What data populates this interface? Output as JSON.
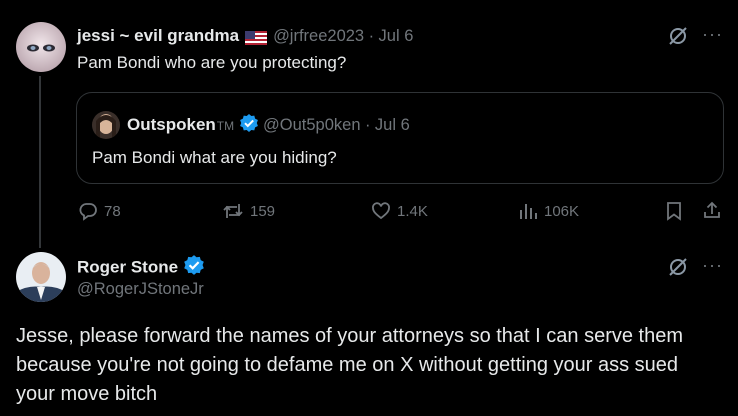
{
  "parent_tweet": {
    "display_name": "jessi ~ evil grandma",
    "flag": "us-flag-icon",
    "handle": "@jrfree2023",
    "separator": "·",
    "date": "Jul 6",
    "text": "Pam Bondi who are you protecting?",
    "quote": {
      "display_name": "Outspoken",
      "name_suffix": "TM",
      "handle": "@Out5p0ken",
      "separator": "·",
      "date": "Jul 6",
      "text": "Pam Bondi what are you hiding?"
    },
    "actions": {
      "replies": "78",
      "reposts": "159",
      "likes": "1.4K",
      "views": "106K"
    }
  },
  "reply_tweet": {
    "display_name": "Roger Stone",
    "handle": "@RogerJStoneJr",
    "text": "Jesse, please forward the names of your attorneys so that I can serve them because you're not going to defame me on X without getting your ass sued your move bitch"
  },
  "colors": {
    "background": "#000000",
    "text": "#e7e9ea",
    "muted": "#71767b",
    "verified": "#1d9bf0",
    "border": "#2f3336"
  }
}
